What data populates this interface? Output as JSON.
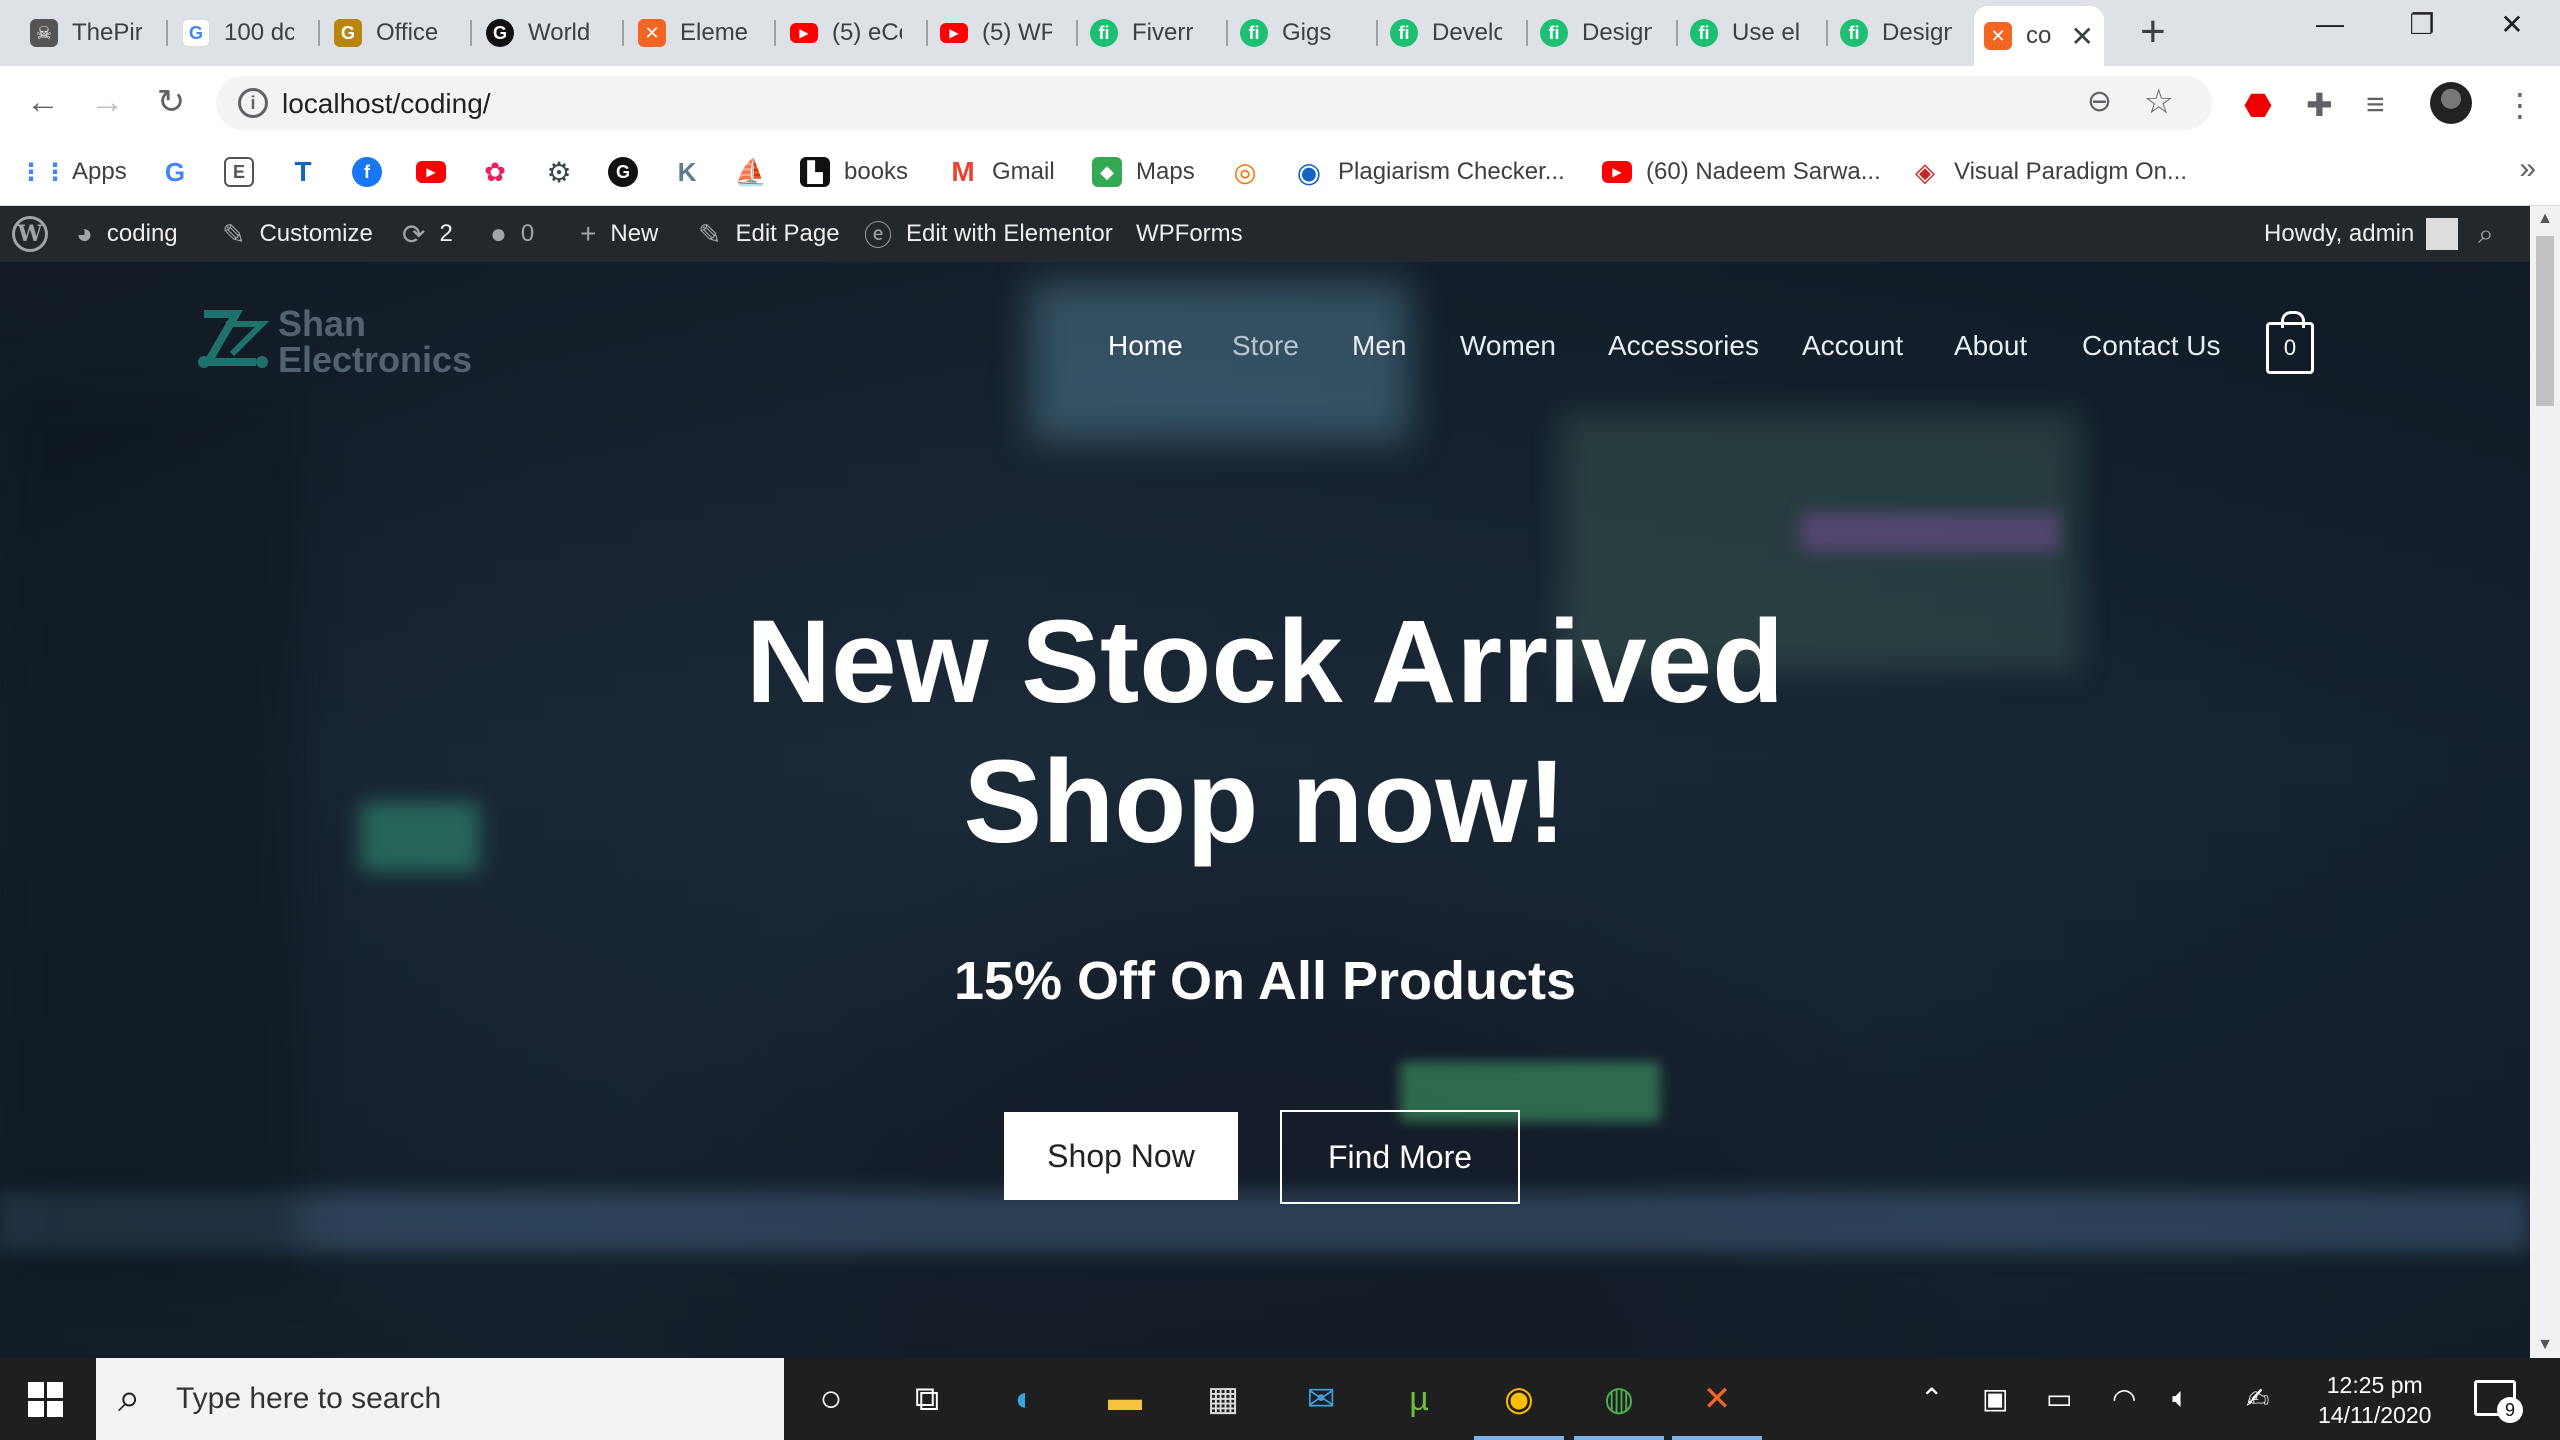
{
  "browser": {
    "tabs": [
      {
        "label": "ThePir",
        "icon": "pirate-icon",
        "color": "#333333"
      },
      {
        "label": "100 dc",
        "icon": "google-icon",
        "color": "#ffffff"
      },
      {
        "label": "Office",
        "icon": "grammarly-icon",
        "color": "#b8860b"
      },
      {
        "label": "World",
        "icon": "github-icon",
        "color": "#111111"
      },
      {
        "label": "Eleme",
        "icon": "xampp-icon",
        "color": "#f26522"
      },
      {
        "label": "(5) eCc",
        "icon": "youtube-icon",
        "color": "#ff0000"
      },
      {
        "label": "(5) WP",
        "icon": "youtube-icon",
        "color": "#ff0000"
      },
      {
        "label": "Fiverr",
        "icon": "fiverr-icon",
        "color": "#1dbf73"
      },
      {
        "label": "Gigs",
        "icon": "fiverr-icon",
        "color": "#1dbf73"
      },
      {
        "label": "Develc",
        "icon": "fiverr-icon",
        "color": "#1dbf73"
      },
      {
        "label": "Design",
        "icon": "fiverr-icon",
        "color": "#1dbf73"
      },
      {
        "label": "Use el",
        "icon": "fiverr-icon",
        "color": "#1dbf73"
      },
      {
        "label": "Design",
        "icon": "fiverr-icon",
        "color": "#1dbf73"
      },
      {
        "label": "co",
        "icon": "xampp-icon",
        "color": "#f26522",
        "active": true
      }
    ],
    "url": "localhost/coding/",
    "bookmarks": [
      {
        "label": "Apps",
        "icon": "apps-grid-icon"
      },
      {
        "label": "",
        "icon": "google-icon"
      },
      {
        "label": "",
        "icon": "reader-icon"
      },
      {
        "label": "",
        "icon": "t2-icon"
      },
      {
        "label": "",
        "icon": "facebook-icon"
      },
      {
        "label": "",
        "icon": "youtube-icon"
      },
      {
        "label": "",
        "icon": "pinwheel-icon"
      },
      {
        "label": "",
        "icon": "gear-icon"
      },
      {
        "label": "",
        "icon": "github-icon"
      },
      {
        "label": "",
        "icon": "k-icon"
      },
      {
        "label": "",
        "icon": "ship-icon"
      },
      {
        "label": "books",
        "icon": "books-icon"
      },
      {
        "label": "Gmail",
        "icon": "gmail-icon"
      },
      {
        "label": "Maps",
        "icon": "maps-icon"
      },
      {
        "label": "",
        "icon": "orange-logo-icon"
      },
      {
        "label": "Plagiarism Checker...",
        "icon": "plagiarism-icon"
      },
      {
        "label": "(60) Nadeem Sarwa...",
        "icon": "youtube-icon"
      },
      {
        "label": "Visual Paradigm On...",
        "icon": "visual-paradigm-icon"
      }
    ]
  },
  "wpbar": {
    "site": "coding",
    "customize": "Customize",
    "updates": "2",
    "comments": "0",
    "new": "New",
    "edit_page": "Edit Page",
    "elementor": "Edit with Elementor",
    "wpforms": "WPForms",
    "howdy": "Howdy, admin"
  },
  "site": {
    "logo_line1": "Shan",
    "logo_line2": "Electronics",
    "nav": [
      "Home",
      "Store",
      "Men",
      "Women",
      "Accessories",
      "Account",
      "About",
      "Contact Us"
    ],
    "cart_count": "0",
    "hero_line1": "New Stock Arrived",
    "hero_line2": "Shop now!",
    "hero_sub": "15% Off On All Products",
    "btn_primary": "Shop Now",
    "btn_secondary": "Find More"
  },
  "taskbar": {
    "search_placeholder": "Type here to search",
    "time": "12:25 pm",
    "date": "14/11/2020",
    "notifications": "9"
  }
}
